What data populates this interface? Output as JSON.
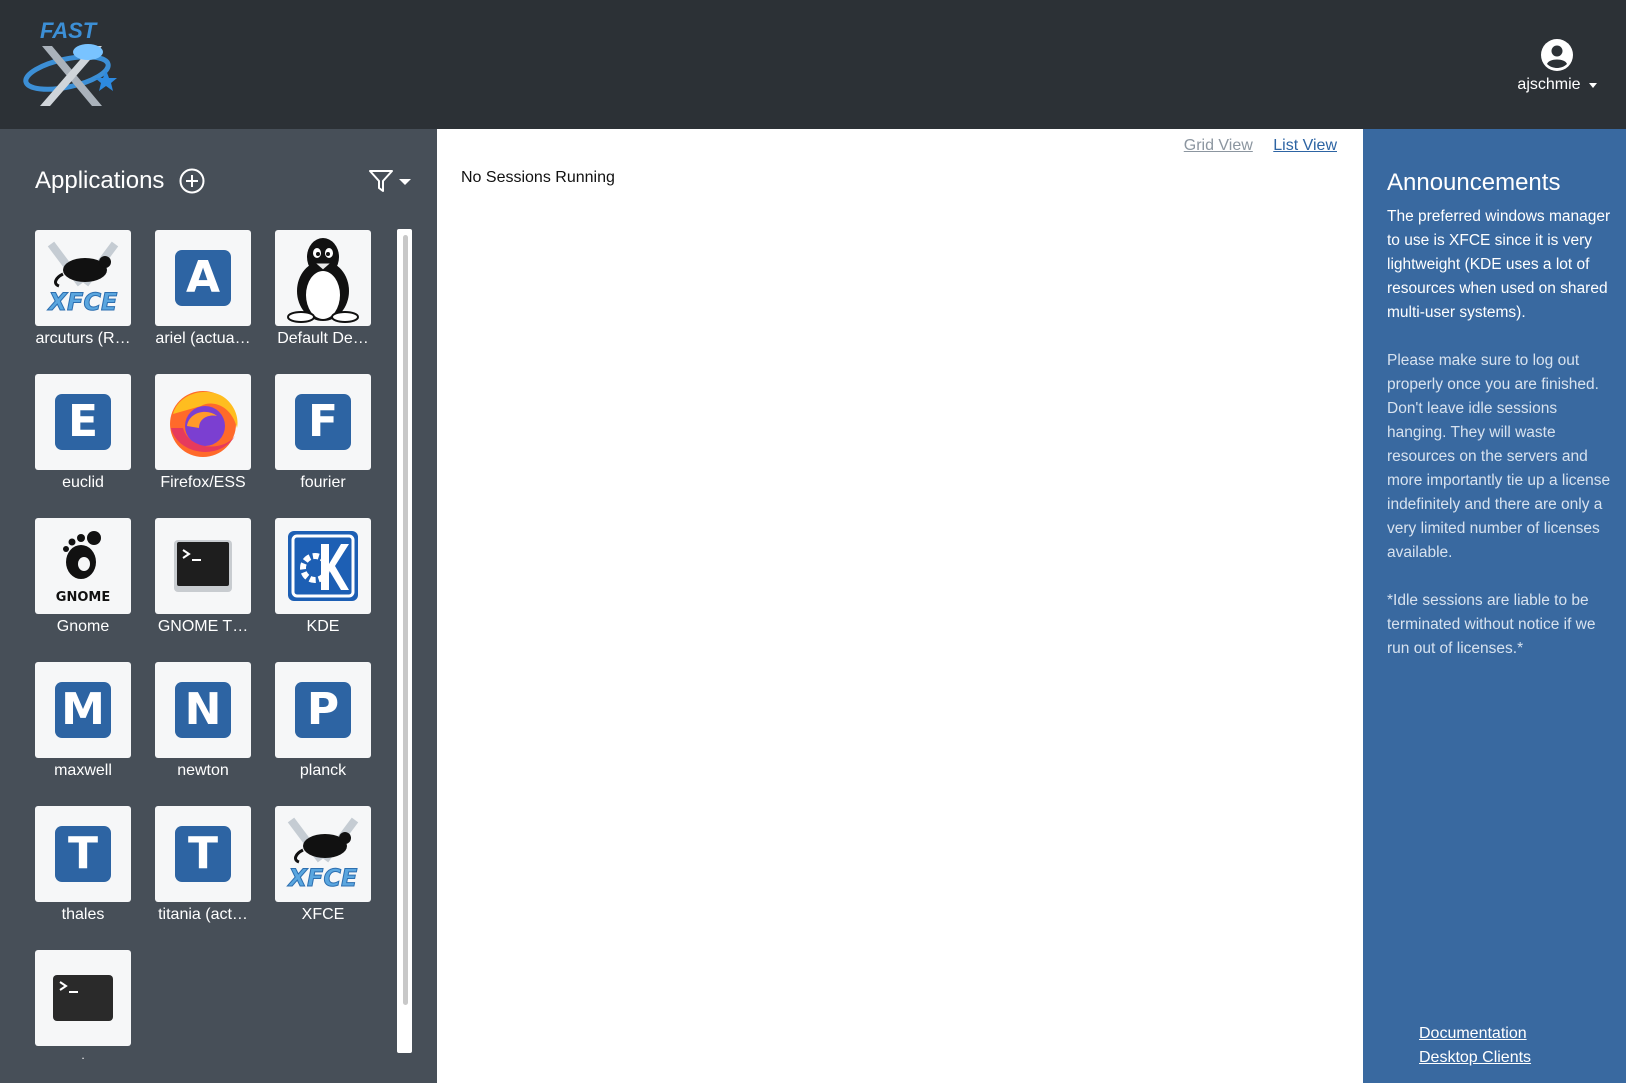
{
  "header": {
    "logo_text": "FAST",
    "user": {
      "name": "ajschmie",
      "icon": "account-circle-icon"
    }
  },
  "sidebar": {
    "title": "Applications",
    "add_icon": "plus-circle-icon",
    "filter_icon": "filter-icon",
    "apps": [
      {
        "label": "arcuturs (R…",
        "icon": "xfce-icon"
      },
      {
        "label": "ariel (actua…",
        "icon": "letter-a-icon",
        "letter": "A"
      },
      {
        "label": "Default De…",
        "icon": "linux-penguin-icon"
      },
      {
        "label": "euclid",
        "icon": "letter-e-icon",
        "letter": "E"
      },
      {
        "label": "Firefox/ESS",
        "icon": "firefox-icon"
      },
      {
        "label": "fourier",
        "icon": "letter-f-icon",
        "letter": "F"
      },
      {
        "label": "Gnome",
        "icon": "gnome-icon",
        "brand": "GNOME"
      },
      {
        "label": "GNOME T…",
        "icon": "terminal-icon"
      },
      {
        "label": "KDE",
        "icon": "kde-icon"
      },
      {
        "label": "maxwell",
        "icon": "letter-m-icon",
        "letter": "M"
      },
      {
        "label": "newton",
        "icon": "letter-n-icon",
        "letter": "N"
      },
      {
        "label": "planck",
        "icon": "letter-p-icon",
        "letter": "P"
      },
      {
        "label": "thales",
        "icon": "letter-t-icon",
        "letter": "T"
      },
      {
        "label": "titania (act…",
        "icon": "letter-t-icon",
        "letter": "T"
      },
      {
        "label": "XFCE",
        "icon": "xfce-icon"
      },
      {
        "label": ".",
        "icon": "terminal-dark-icon"
      }
    ]
  },
  "main": {
    "grid_view": "Grid View",
    "list_view": "List View",
    "empty_message": "No Sessions Running"
  },
  "announcements": {
    "title": "Announcements",
    "paragraphs": [
      "The preferred windows manager to use is XFCE since it is very lightweight (KDE uses a lot of resources when used on shared multi-user systems).",
      "Please make sure to log out properly once you are finished. Don't leave idle sessions hanging. They will waste resources on the servers and more importantly tie up a license indefinitely and there are only a very limited number of licenses available.",
      "*Idle sessions are liable to be terminated without notice if we run out of licenses.*"
    ],
    "links": [
      "Documentation",
      "Desktop Clients"
    ]
  },
  "colors": {
    "header_bg": "#2c3136",
    "sidebar_bg": "#474f58",
    "accent": "#2d64a3",
    "announce_bg": "#3969a0"
  }
}
